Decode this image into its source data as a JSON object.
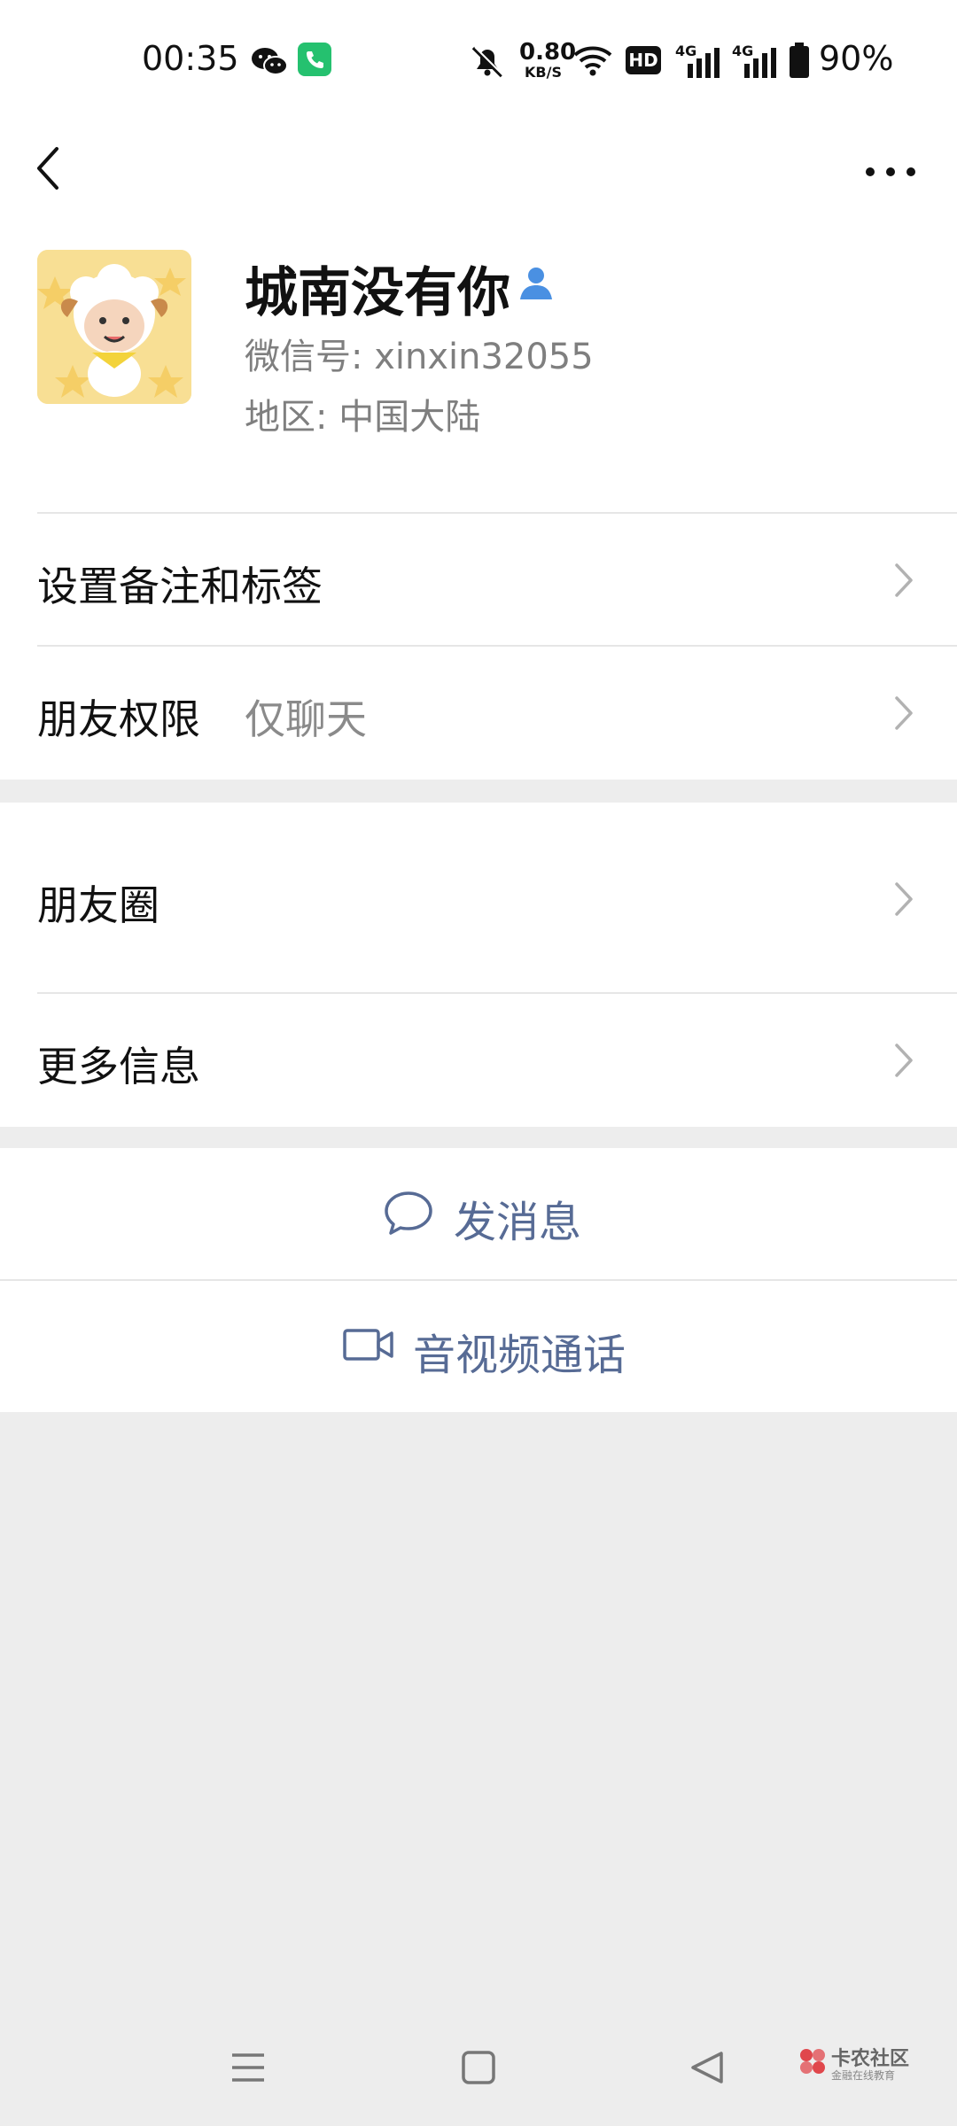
{
  "status_bar": {
    "time": "00:35",
    "network_speed": "0.80",
    "network_speed_unit": "KB/S",
    "hd_label": "HD",
    "signal_label_1": "4G",
    "signal_label_2": "4G",
    "battery": "90%"
  },
  "header": {
    "back_icon": "chevron-left-icon",
    "more_icon": "more-horizontal-icon"
  },
  "profile": {
    "name": "城南没有你",
    "wechat_id": "微信号: xinxin32055",
    "region": "地区: 中国大陆"
  },
  "list": {
    "remark_label": "设置备注和标签",
    "permission_label": "朋友权限",
    "permission_value": "仅聊天",
    "moments_label": "朋友圈",
    "more_info_label": "更多信息"
  },
  "actions": {
    "send_message": "发消息",
    "video_call": "音视频通话"
  },
  "watermark": {
    "title": "卡农社区",
    "subtitle": "金融在线教育"
  },
  "colors": {
    "action_blue": "#576b95",
    "background": "#ededed",
    "verified_blue": "#4a90e2"
  }
}
